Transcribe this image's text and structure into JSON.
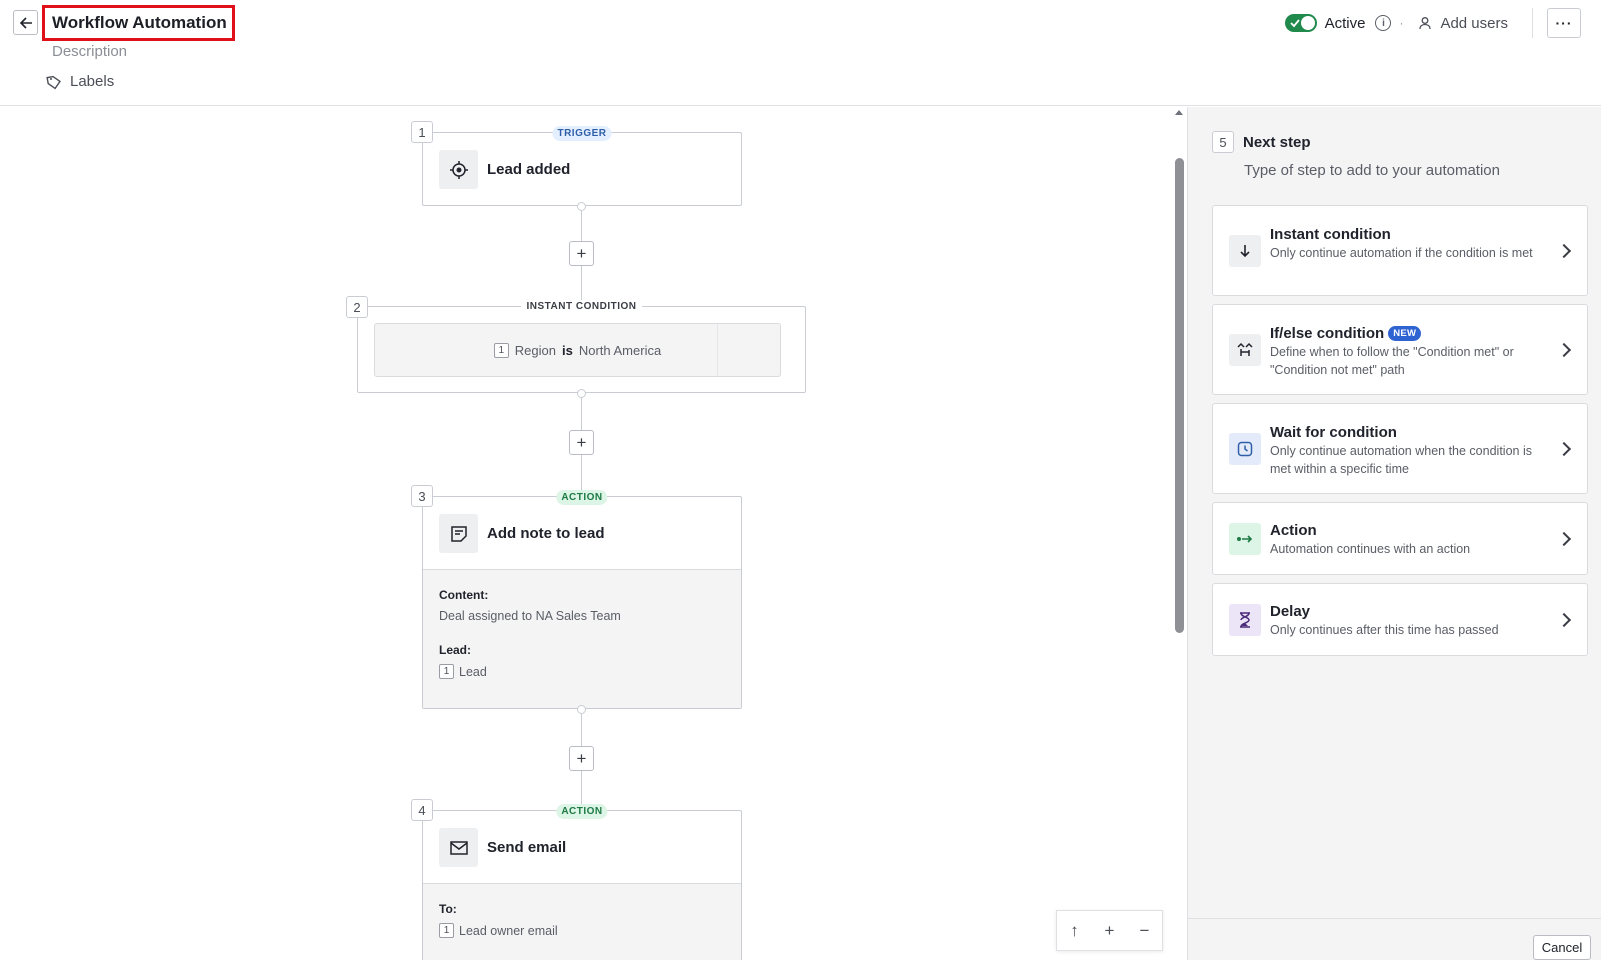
{
  "header": {
    "title": "Workflow Automation",
    "description_placeholder": "Description",
    "labels": "Labels",
    "active_label": "Active",
    "active_on": true,
    "add_users": "Add users",
    "more_label": "···"
  },
  "flow": {
    "trigger": {
      "number": "1",
      "tag": "TRIGGER",
      "title": "Lead added"
    },
    "condition": {
      "number": "2",
      "tag": "INSTANT CONDITION",
      "ref_num": "1",
      "field": "Region",
      "operator": "is",
      "value": "North America"
    },
    "action1": {
      "number": "3",
      "tag": "ACTION",
      "title": "Add note to lead",
      "content_label": "Content:",
      "content_value": "Deal assigned to NA Sales Team",
      "lead_label": "Lead:",
      "lead_ref": "1",
      "lead_value": "Lead"
    },
    "action2": {
      "number": "4",
      "tag": "ACTION",
      "title": "Send email",
      "to_label": "To:",
      "to_ref": "1",
      "to_value": "Lead owner email"
    },
    "plus": "+"
  },
  "zoom": {
    "up": "↑",
    "plus": "+",
    "minus": "−"
  },
  "panel": {
    "number": "5",
    "title": "Next step",
    "subtitle": "Type of step to add to your automation",
    "steps": [
      {
        "name": "Instant condition",
        "desc": "Only continue automation if the condition is met",
        "icon": "arrow-down-icon"
      },
      {
        "name": "If/else condition",
        "badge": "NEW",
        "desc": "Define when to follow the \"Condition met\" or \"Condition not met\" path",
        "icon": "branch-icon"
      },
      {
        "name": "Wait for condition",
        "desc": "Only continue automation when the condition is met within a specific time",
        "icon": "clock-icon"
      },
      {
        "name": "Action",
        "desc": "Automation continues with an action",
        "icon": "action-arrow-icon"
      },
      {
        "name": "Delay",
        "desc": "Only continues after this time has passed",
        "icon": "hourglass-icon"
      }
    ],
    "cancel": "Cancel"
  },
  "colors": {
    "accent_green": "#1f8a4c",
    "highlight_red": "#e0101b",
    "new_badge": "#2f63d1"
  }
}
